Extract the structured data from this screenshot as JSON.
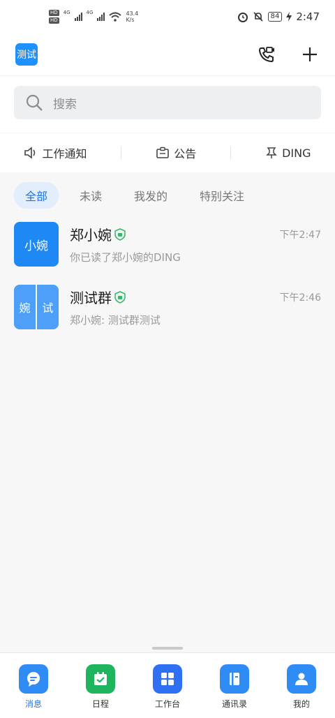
{
  "status_bar": {
    "hd1": "HD",
    "hd2": "HD",
    "net1": "4G",
    "net2": "4G",
    "speed_value": "43.4",
    "speed_unit": "K/s",
    "battery": "84",
    "time": "2:47"
  },
  "header": {
    "org_name": "测试"
  },
  "search": {
    "placeholder": "搜索"
  },
  "quick_actions": [
    {
      "label": "工作通知"
    },
    {
      "label": "公告"
    },
    {
      "label": "DING"
    }
  ],
  "filter_tabs": [
    {
      "label": "全部",
      "active": true
    },
    {
      "label": "未读",
      "active": false
    },
    {
      "label": "我发的",
      "active": false
    },
    {
      "label": "特别关注",
      "active": false
    }
  ],
  "conversations": [
    {
      "name": "郑小婉",
      "avatar_text": "小婉",
      "time": "下午2:47",
      "preview": "你已读了郑小婉的DING"
    },
    {
      "name": "测试群",
      "avatar_left": "婉",
      "avatar_right": "试",
      "time": "下午2:46",
      "preview": "郑小婉: 测试群测试"
    }
  ],
  "bottom_nav": [
    {
      "label": "消息",
      "icon": "chat-icon",
      "color": "#2f8cf4",
      "active": true
    },
    {
      "label": "日程",
      "icon": "calendar-icon",
      "color": "#1fb45e",
      "active": false
    },
    {
      "label": "工作台",
      "icon": "grid-icon",
      "color": "#2f6ff4",
      "active": false
    },
    {
      "label": "通讯录",
      "icon": "contacts-icon",
      "color": "#2f8cf4",
      "active": false
    },
    {
      "label": "我的",
      "icon": "profile-icon",
      "color": "#2f8cf4",
      "active": false
    }
  ],
  "colors": {
    "accent": "#1b73e8",
    "verified": "#3cb371"
  }
}
